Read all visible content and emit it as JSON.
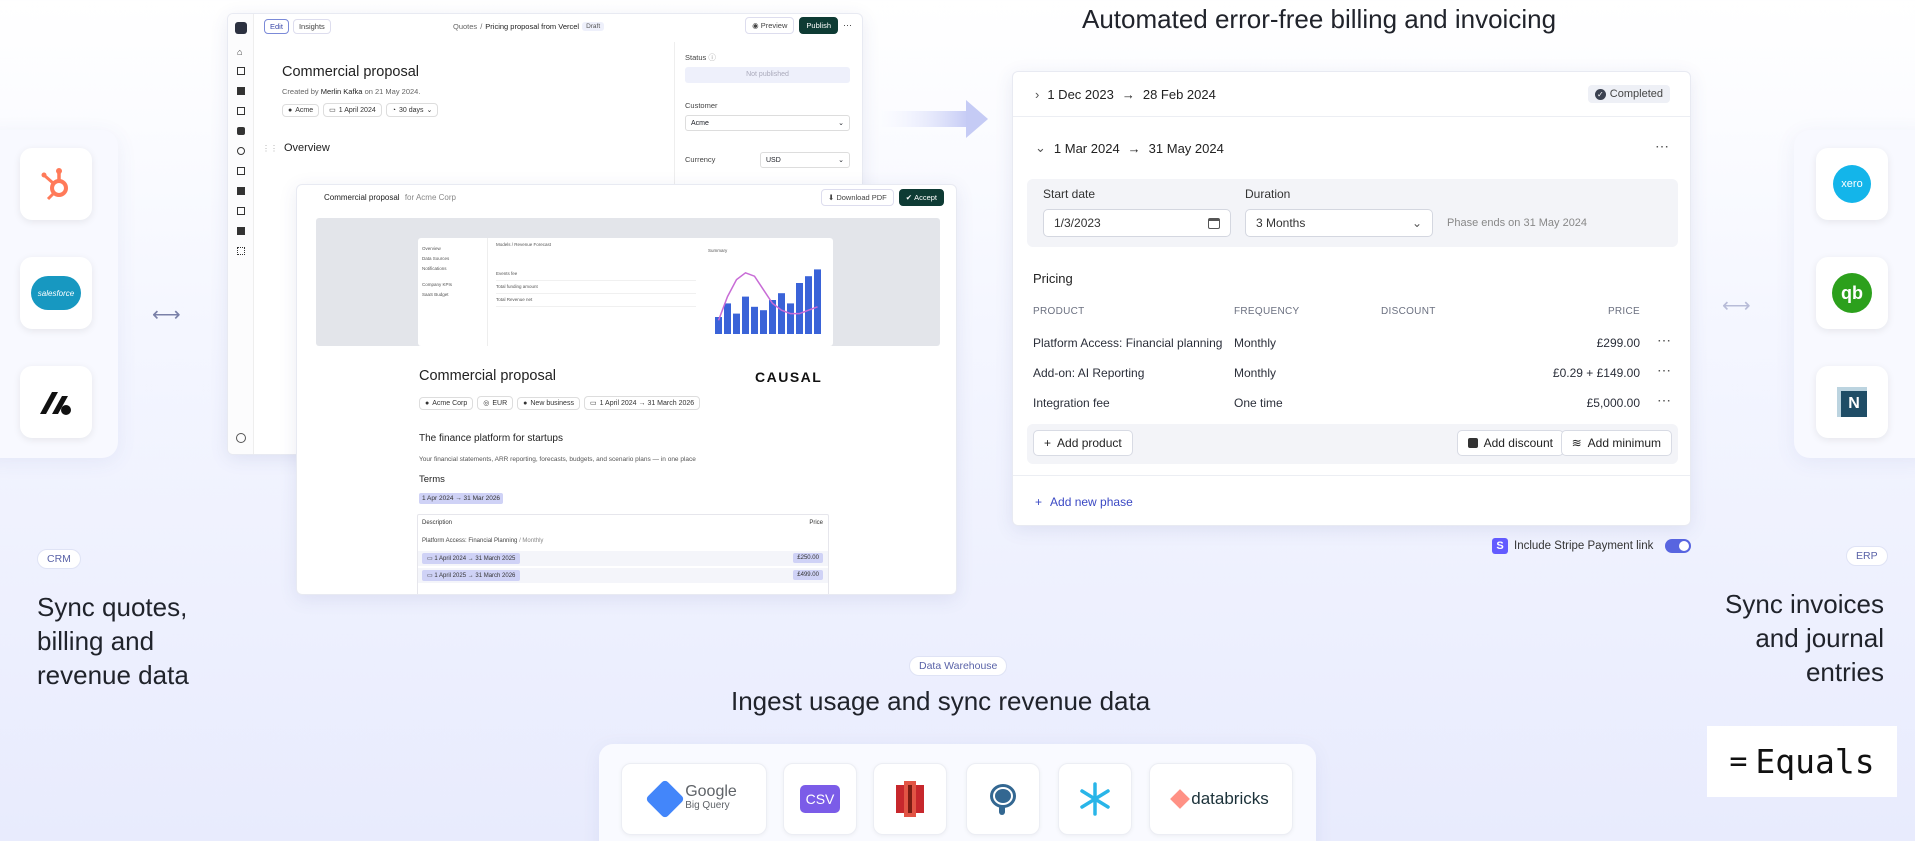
{
  "headline_top": "Automated error-free billing and invoicing",
  "left": {
    "tag": "CRM",
    "text_lines": [
      "Sync quotes,",
      "billing and",
      "revenue data"
    ],
    "tiles": [
      "hubspot-icon",
      "salesforce-icon",
      "attio-icon"
    ],
    "salesforce_text": "salesforce"
  },
  "right": {
    "tag": "ERP",
    "text_lines": [
      "Sync invoices",
      "and journal",
      "entries"
    ],
    "tiles": [
      "xero-icon",
      "quickbooks-icon",
      "netsuite-icon"
    ],
    "xero_text": "xero",
    "qb_text": "qb",
    "ns_text": "N"
  },
  "bottom": {
    "tag": "Data Warehouse",
    "headline": "Ingest usage and sync revenue data",
    "logos": {
      "google": "Google",
      "bigquery": "Big Query",
      "csv": "CSV",
      "databricks": "databricks"
    }
  },
  "brand": {
    "mark": "=",
    "name": "Equals"
  },
  "editor": {
    "tabs": [
      "Edit",
      "Insights"
    ],
    "breadcrumb_root": "Quotes",
    "breadcrumb_sep": "/",
    "breadcrumb_page": "Pricing proposal from Vercel",
    "draft_badge": "Draft",
    "preview": "Preview",
    "publish": "Publish",
    "title": "Commercial proposal",
    "created_prefix": "Created by",
    "created_by": "Merlin Kafka",
    "created_suffix": "on 21 May 2024.",
    "chips": [
      "Acme",
      "1 April 2024",
      "30 days"
    ],
    "overview": "Overview",
    "status_label": "Status",
    "status_value": "Not published",
    "customer_label": "Customer",
    "customer_value": "Acme",
    "currency_label": "Currency",
    "currency_value": "USD"
  },
  "proposal": {
    "top_title": "Commercial proposal",
    "top_for": "for Acme Corp",
    "download": "Download PDF",
    "accept": "Accept",
    "title": "Commercial proposal",
    "brand": "CAUSAL",
    "chips": [
      "Acme Corp",
      "EUR",
      "New business",
      "1 April 2024  →  31 March 2026"
    ],
    "subtitle": "The finance platform for startups",
    "desc": "Your financial statements, ARR reporting, forecasts, budgets, and scenario plans — in one place",
    "terms": "Terms",
    "term_range": "1 Apr 2024  →  31 Mar 2026",
    "table_desc": "Description",
    "table_price": "Price",
    "row_desc": "Platform Access: Financial Planning",
    "row_freq": "/ Monthly",
    "periods": [
      {
        "range": "1 April 2024  →  31 March 2025",
        "price": "£250.00"
      },
      {
        "range": "1 April 2025  →  31 March 2026",
        "price": "£499.00"
      }
    ],
    "inner": {
      "summary": "Summary",
      "side_items": [
        "Overview",
        "Data Sources",
        "Notifications",
        "Company KPIs",
        "SaaS Budget"
      ],
      "crumb": "Models / Revenue Forecast",
      "rows": [
        "Events fee",
        "Total funding amount",
        "Total Revenue net"
      ],
      "chart_bars": [
        0.25,
        0.45,
        0.3,
        0.55,
        0.4,
        0.35,
        0.5,
        0.6,
        0.45,
        0.75,
        0.85,
        0.95
      ],
      "chart_line": [
        0.2,
        0.55,
        0.8,
        0.9,
        0.85,
        0.65,
        0.45,
        0.35,
        0.3,
        0.3,
        0.35,
        0.4
      ]
    }
  },
  "billing": {
    "phase1": {
      "start": "1 Dec 2023",
      "end": "28 Feb 2024",
      "status": "Completed"
    },
    "phase2": {
      "start": "1 Mar 2024",
      "end": "31 May 2024"
    },
    "arrow": "→",
    "start_label": "Start date",
    "start_value": "1/3/2023",
    "duration_label": "Duration",
    "duration_value": "3 Months",
    "phase_ends": "Phase ends on 31 May 2024",
    "pricing": "Pricing",
    "headers": [
      "PRODUCT",
      "FREQUENCY",
      "DISCOUNT",
      "PRICE"
    ],
    "rows": [
      {
        "product": "Platform Access: Financial planning",
        "freq": "Monthly",
        "discount": "",
        "price": "£299.00"
      },
      {
        "product": "Add-on: AI Reporting",
        "freq": "Monthly",
        "discount": "",
        "price": "£0.29 + £149.00"
      },
      {
        "product": "Integration fee",
        "freq": "One time",
        "discount": "",
        "price": "£5,000.00"
      }
    ],
    "add_product": "Add product",
    "add_discount": "Add discount",
    "add_minimum": "Add minimum",
    "add_phase": "Add new phase",
    "stripe_label": "Include Stripe Payment link",
    "stripe_on": true
  }
}
